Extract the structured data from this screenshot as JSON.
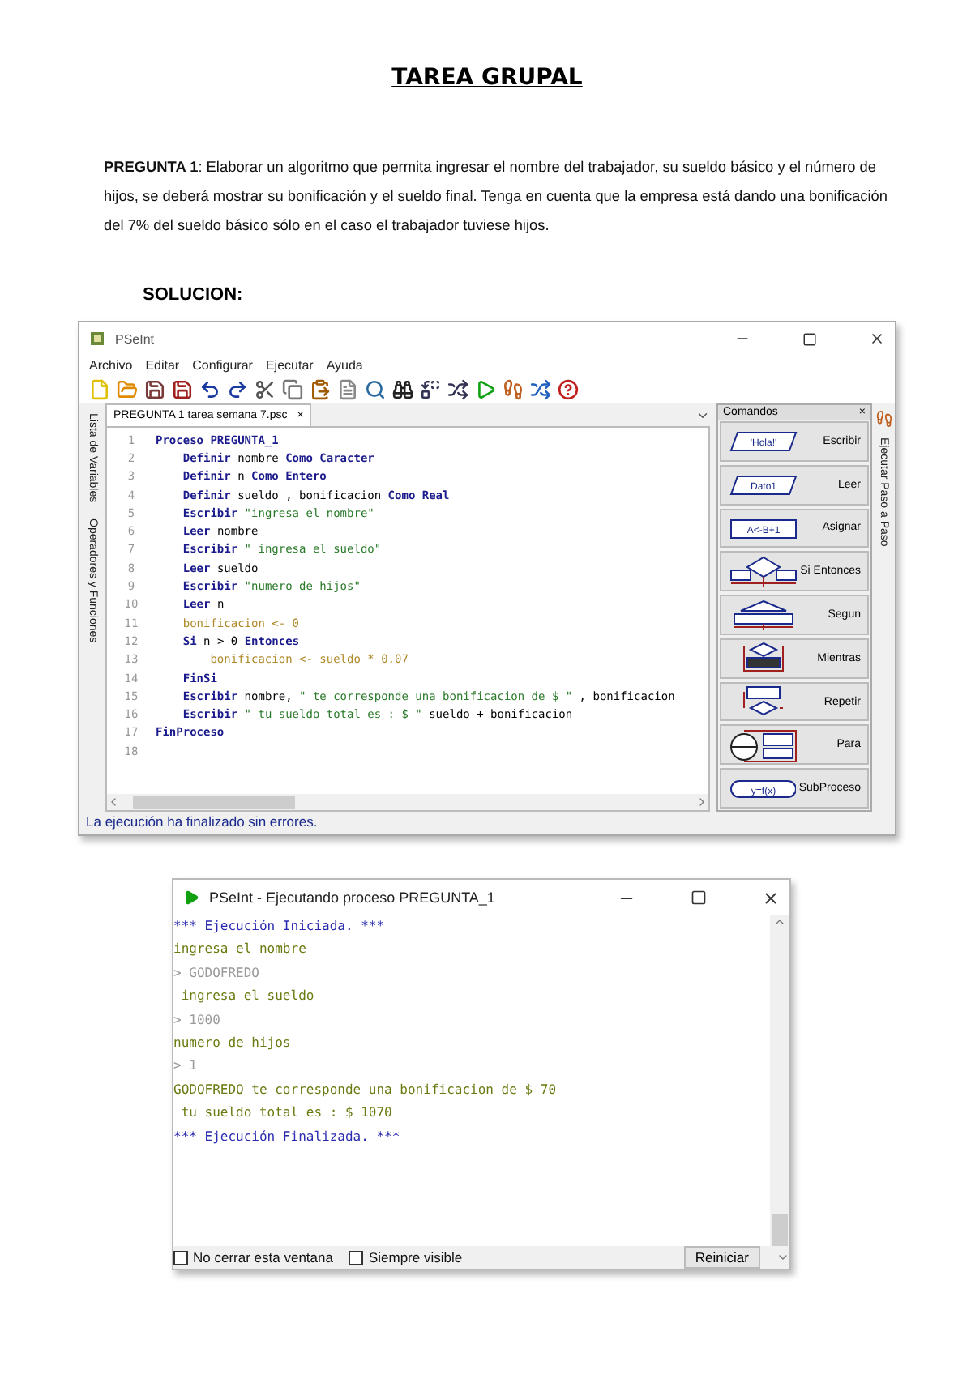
{
  "document": {
    "title": "TAREA GRUPAL",
    "question": "**PREGUNTA 1**:  Elaborar un algoritmo que permita ingresar el nombre del trabajador, su sueldo básico y el número de hijos, se deberá mostrar su bonificación y el sueldo final. Tenga en cuenta que la empresa está dando una bonificación del 7% del sueldo básico sólo en el caso el trabajador tuviese hijos.",
    "solution_heading": "SOLUCION:"
  },
  "editor_window": {
    "title": "PSeInt",
    "menu": [
      "Archivo",
      "Editar",
      "Configurar",
      "Ejecutar",
      "Ayuda"
    ],
    "tab": {
      "label": "PREGUNTA 1 tarea semana 7.psc",
      "close": "×"
    },
    "left_panels": [
      "Lista de Variables",
      "Operadores y Funciones"
    ],
    "right_panel": "Ejecutar Paso a Paso",
    "code": [
      {
        "number": "1",
        "tokens": [
          {
            "text": "Proceso PREGUNTA_1",
            "kind": "keyword"
          }
        ]
      },
      {
        "number": "2",
        "tokens": [
          {
            "text": "    Definir ",
            "kind": "keyword"
          },
          {
            "text": "nombre ",
            "kind": "plain"
          },
          {
            "text": "Como Caracter",
            "kind": "keyword"
          }
        ]
      },
      {
        "number": "3",
        "tokens": [
          {
            "text": "    Definir ",
            "kind": "keyword"
          },
          {
            "text": "n ",
            "kind": "plain"
          },
          {
            "text": "Como Entero",
            "kind": "keyword"
          }
        ]
      },
      {
        "number": "4",
        "tokens": [
          {
            "text": "    Definir ",
            "kind": "keyword"
          },
          {
            "text": "sueldo , bonificacion ",
            "kind": "plain"
          },
          {
            "text": "Como Real",
            "kind": "keyword"
          }
        ]
      },
      {
        "number": "5",
        "tokens": [
          {
            "text": "    Escribir ",
            "kind": "keyword"
          },
          {
            "text": "\"ingresa el nombre\"",
            "kind": "string"
          }
        ]
      },
      {
        "number": "6",
        "tokens": [
          {
            "text": "    Leer ",
            "kind": "keyword"
          },
          {
            "text": "nombre",
            "kind": "plain"
          }
        ]
      },
      {
        "number": "7",
        "tokens": [
          {
            "text": "    Escribir ",
            "kind": "keyword"
          },
          {
            "text": "\" ingresa el sueldo\"",
            "kind": "string"
          }
        ]
      },
      {
        "number": "8",
        "tokens": [
          {
            "text": "    Leer ",
            "kind": "keyword"
          },
          {
            "text": "sueldo",
            "kind": "plain"
          }
        ]
      },
      {
        "number": "9",
        "tokens": [
          {
            "text": "    Escribir ",
            "kind": "keyword"
          },
          {
            "text": "\"numero de hijos\"",
            "kind": "string"
          }
        ]
      },
      {
        "number": "10",
        "tokens": [
          {
            "text": "    Leer ",
            "kind": "keyword"
          },
          {
            "text": "n",
            "kind": "plain"
          }
        ]
      },
      {
        "number": "11",
        "tokens": [
          {
            "text": "    bonificacion <- 0",
            "kind": "faded"
          }
        ]
      },
      {
        "number": "12",
        "tokens": [
          {
            "text": "    Si ",
            "kind": "keyword"
          },
          {
            "text": "n > 0 ",
            "kind": "plain"
          },
          {
            "text": "Entonces",
            "kind": "keyword"
          }
        ]
      },
      {
        "number": "13",
        "tokens": [
          {
            "text": "        bonificacion <- sueldo * 0.07",
            "kind": "faded"
          }
        ]
      },
      {
        "number": "14",
        "tokens": [
          {
            "text": "    FinSi",
            "kind": "keyword"
          }
        ]
      },
      {
        "number": "15",
        "tokens": [
          {
            "text": "    Escribir ",
            "kind": "keyword"
          },
          {
            "text": "nombre, ",
            "kind": "plain"
          },
          {
            "text": "\" te corresponde una bonificacion de $ \"",
            "kind": "string"
          },
          {
            "text": " , bonificacion",
            "kind": "plain"
          }
        ]
      },
      {
        "number": "16",
        "tokens": [
          {
            "text": "    Escribir ",
            "kind": "keyword"
          },
          {
            "text": "\" tu sueldo total es : $ \"",
            "kind": "string"
          },
          {
            "text": " sueldo + bonificacion",
            "kind": "plain"
          }
        ]
      },
      {
        "number": "17",
        "tokens": [
          {
            "text": "FinProceso",
            "kind": "keyword"
          }
        ]
      },
      {
        "number": "18"
      }
    ],
    "commands_panel": {
      "title": "Comandos",
      "close": "×",
      "commands": [
        {
          "kind": "write",
          "label": "Escribir",
          "symbol": "'Hola!'"
        },
        {
          "kind": "read",
          "label": "Leer",
          "symbol": "Dato1"
        },
        {
          "kind": "assign",
          "label": "Asignar",
          "symbol": "A<-B+1"
        },
        {
          "kind": "if",
          "label": "Si Entonces"
        },
        {
          "kind": "switch",
          "label": "Segun"
        },
        {
          "kind": "while",
          "label": "Mientras"
        },
        {
          "kind": "repeat",
          "label": "Repetir"
        },
        {
          "kind": "for",
          "label": "Para"
        },
        {
          "kind": "sub",
          "label": "SubProceso",
          "symbol": "y=f(x)"
        }
      ]
    },
    "status": "La ejecución ha finalizado sin errores."
  },
  "console_window": {
    "title": "PSeInt - Ejecutando proceso PREGUNTA_1",
    "lines": [
      {
        "text": "*** Ejecución Iniciada. ***",
        "kind": "info"
      },
      {
        "text": "ingresa el nombre",
        "kind": "output"
      },
      {
        "text": "> GODOFREDO",
        "kind": "input"
      },
      {
        "text": " ingresa el sueldo",
        "kind": "output"
      },
      {
        "text": "> 1000",
        "kind": "input"
      },
      {
        "text": "numero de hijos",
        "kind": "output"
      },
      {
        "text": "> 1",
        "kind": "input"
      },
      {
        "text": "GODOFREDO te corresponde una bonificacion de $ 70",
        "kind": "output"
      },
      {
        "text": " tu sueldo total es : $ 1070",
        "kind": "output"
      },
      {
        "text": "*** Ejecución Finalizada. ***",
        "kind": "info"
      }
    ],
    "options": [
      {
        "label": "No cerrar esta ventana",
        "checked": false
      },
      {
        "label": "Siempre visible",
        "checked": false
      }
    ],
    "restart_button": "Reiniciar"
  }
}
